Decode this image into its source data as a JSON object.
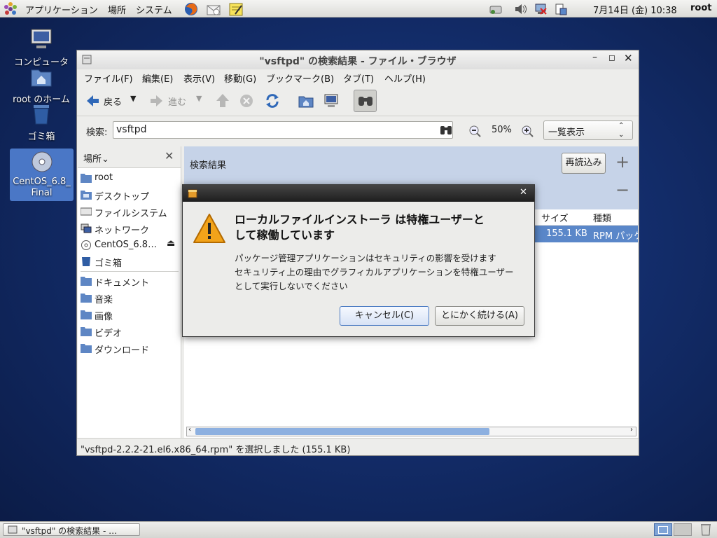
{
  "top_panel": {
    "menus": [
      "アプリケーション",
      "場所",
      "システム"
    ],
    "clock": "7月14日 (金) 10:38",
    "user": "root"
  },
  "desktop": {
    "icons": [
      "コンピュータ",
      "root のホーム",
      "ゴミ箱",
      "CentOS_6.8_\nFinal"
    ]
  },
  "window": {
    "title": "\"vsftpd\" の検索結果 - ファイル・ブラウザ",
    "menu": [
      "ファイル(F)",
      "編集(E)",
      "表示(V)",
      "移動(G)",
      "ブックマーク(B)",
      "タブ(T)",
      "ヘルプ(H)"
    ],
    "toolbar": {
      "back": "戻る",
      "forward": "進む"
    },
    "search": {
      "label": "検索:",
      "value": "vsftpd",
      "zoom": "50%",
      "view": "一覧表示"
    },
    "sidebar": {
      "header": "場所",
      "items": [
        "root",
        "デスクトップ",
        "ファイルシステム",
        "ネットワーク",
        "CentOS_6.8…",
        "ゴミ箱",
        "ドキュメント",
        "音楽",
        "画像",
        "ビデオ",
        "ダウンロード"
      ]
    },
    "main": {
      "results_label": "検索結果",
      "reload": "再読込み",
      "columns": {
        "size": "サイズ",
        "type": "種類"
      },
      "row": {
        "size": "155.1 KB",
        "type": "RPM パッケ"
      }
    },
    "status": "\"vsftpd-2.2.2-21.el6.x86_64.rpm\" を選択しました (155.1 KB)"
  },
  "dialog": {
    "heading_line1": "ローカルファイルインストーラ は特権ユーザーと",
    "heading_line2": "して稼働しています",
    "body_line1": "パッケージ管理アプリケーションはセキュリティの影響を受けます",
    "body_line2": "セキュリティ上の理由でグラフィカルアプリケーションを特権ユーザー",
    "body_line3": "として実行しないでください",
    "cancel": "キャンセル(C)",
    "continue": "とにかく続ける(A)"
  },
  "taskbar": {
    "task": "\"vsftpd\" の検索結果 - …"
  }
}
